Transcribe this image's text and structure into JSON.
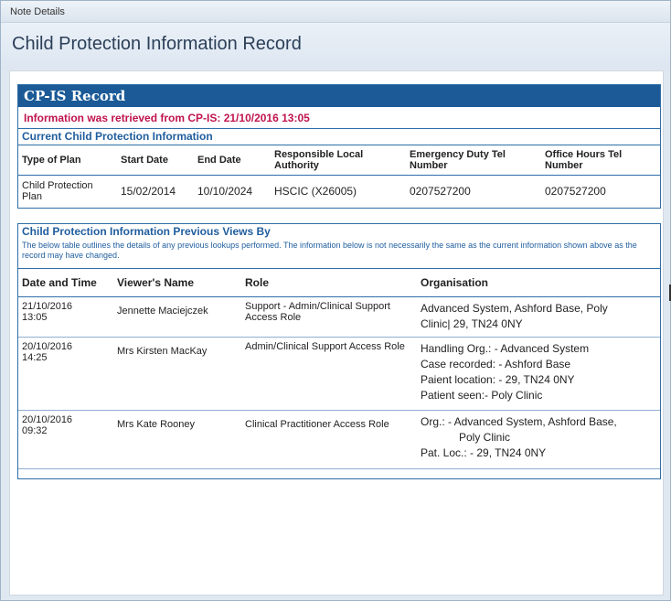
{
  "window": {
    "title": "Note Details"
  },
  "header": {
    "title": "Child Protection Information Record"
  },
  "cp_record": {
    "heading": "CP-IS Record",
    "retrieved": "Information was retrieved from CP-IS: 21/10/2016 13:05",
    "current_title": "Current Child Protection Information",
    "columns": [
      "Type of Plan",
      "Start Date",
      "End Date",
      "Responsible Local Authority",
      "Emergency Duty Tel Number",
      "Office Hours Tel Number"
    ],
    "row": {
      "type_of_plan": "Child Protection Plan",
      "start_date": "15/02/2014",
      "end_date": "10/10/2024",
      "authority": "HSCIC (X26005)",
      "emergency_tel": "0207527200",
      "office_tel": "0207527200"
    }
  },
  "previous_views": {
    "title": "Child Protection Information Previous Views By",
    "description": "The below table outlines the details of any previous lookups performed. The information below is not necessarily the same as the current information shown above as the record may have changed.",
    "columns": [
      "Date and Time",
      "Viewer's Name",
      "Role",
      "Organisation"
    ],
    "rows": [
      {
        "date": "21/10/2016",
        "time": "13:05",
        "viewer": "Jennette Maciejczek",
        "role": "Support - Admin/Clinical Support Access Role",
        "org_lines": [
          "Advanced System, Ashford Base, Poly",
          "Clinic| 29, TN24 0NY"
        ]
      },
      {
        "date": "20/10/2016",
        "time": "14:25",
        "viewer": "Mrs Kirsten MacKay",
        "role": "Admin/Clinical Support Access Role",
        "org_lines": [
          "Handling Org.: - Advanced System",
          "Case recorded: - Ashford Base",
          "Paient location: - 29, TN24 0NY",
          "Patient seen:- Poly Clinic"
        ]
      },
      {
        "date": "20/10/2016",
        "time": "09:32",
        "viewer": "Mrs Kate Rooney",
        "role": "Clinical Practitioner Access Role",
        "org_lines": [
          "Org.: - Advanced System, Ashford Base,",
          "Poly Clinic",
          "Pat. Loc.: - 29, TN24 0NY"
        ]
      }
    ]
  }
}
